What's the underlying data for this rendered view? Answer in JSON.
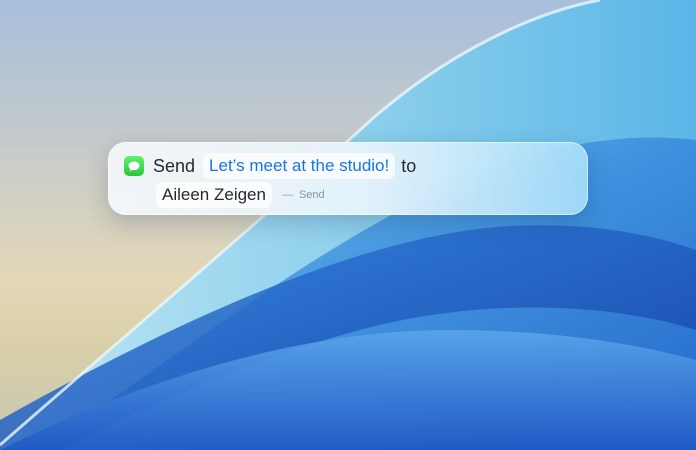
{
  "desktop": {
    "wallpaper_colors": {
      "sky": "#a7bedb",
      "sand": "#e3d8b7",
      "wave_light": "#9fd8ef",
      "wave_mid": "#3f8fd8",
      "wave_deep": "#1a4fb7"
    }
  },
  "action_panel": {
    "app_icon": "messages-app-icon",
    "verb": "Send",
    "message": "Let’s meet at the studio!",
    "connector": "to",
    "recipient": "Aileen Zeigen",
    "hint_dash": "—",
    "hint": "Send",
    "colors": {
      "message_text": "#1a73e8",
      "messages_green": "#34c759"
    }
  }
}
